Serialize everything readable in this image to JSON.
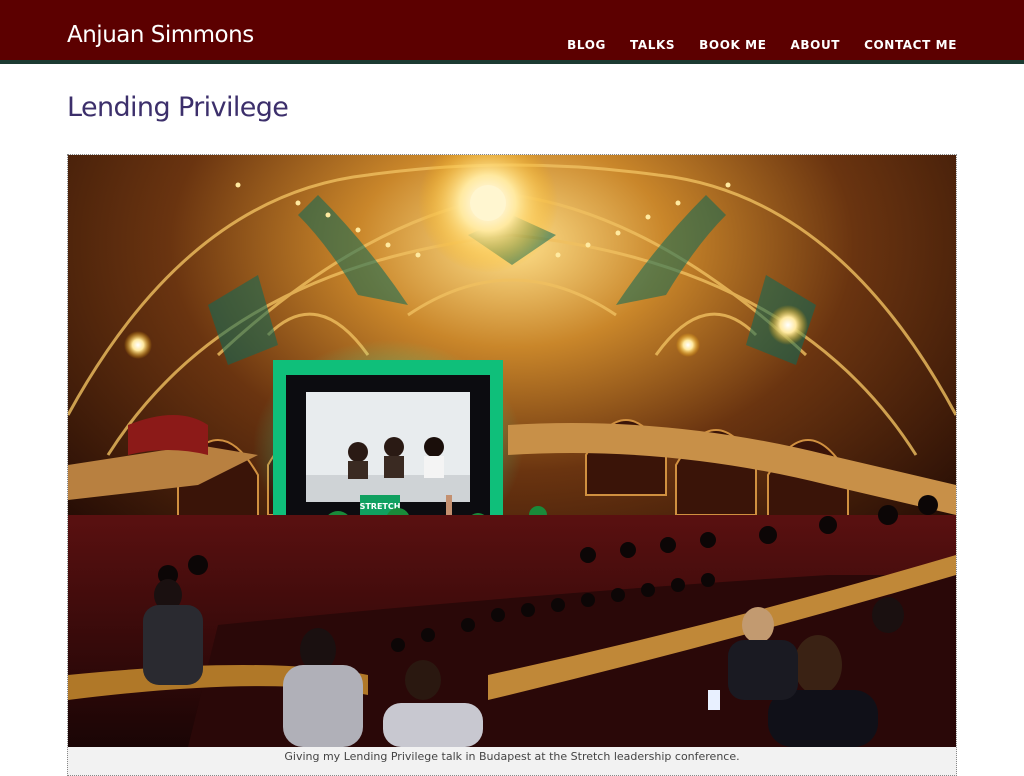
{
  "site": {
    "title": "Anjuan Simmons"
  },
  "nav": {
    "items": [
      {
        "label": "BLOG"
      },
      {
        "label": "TALKS"
      },
      {
        "label": "BOOK ME"
      },
      {
        "label": "ABOUT"
      },
      {
        "label": "CONTACT ME"
      }
    ]
  },
  "post": {
    "title": "Lending Privilege",
    "image_caption": "Giving my Lending Privilege talk in Budapest at the Stretch leadership conference.",
    "stage_sign": "STRETCH"
  },
  "colors": {
    "header_bg": "#5c0000",
    "header_border": "#1c3b32",
    "title_color": "#3c2f6b",
    "stage_glow": "#19d98a"
  }
}
